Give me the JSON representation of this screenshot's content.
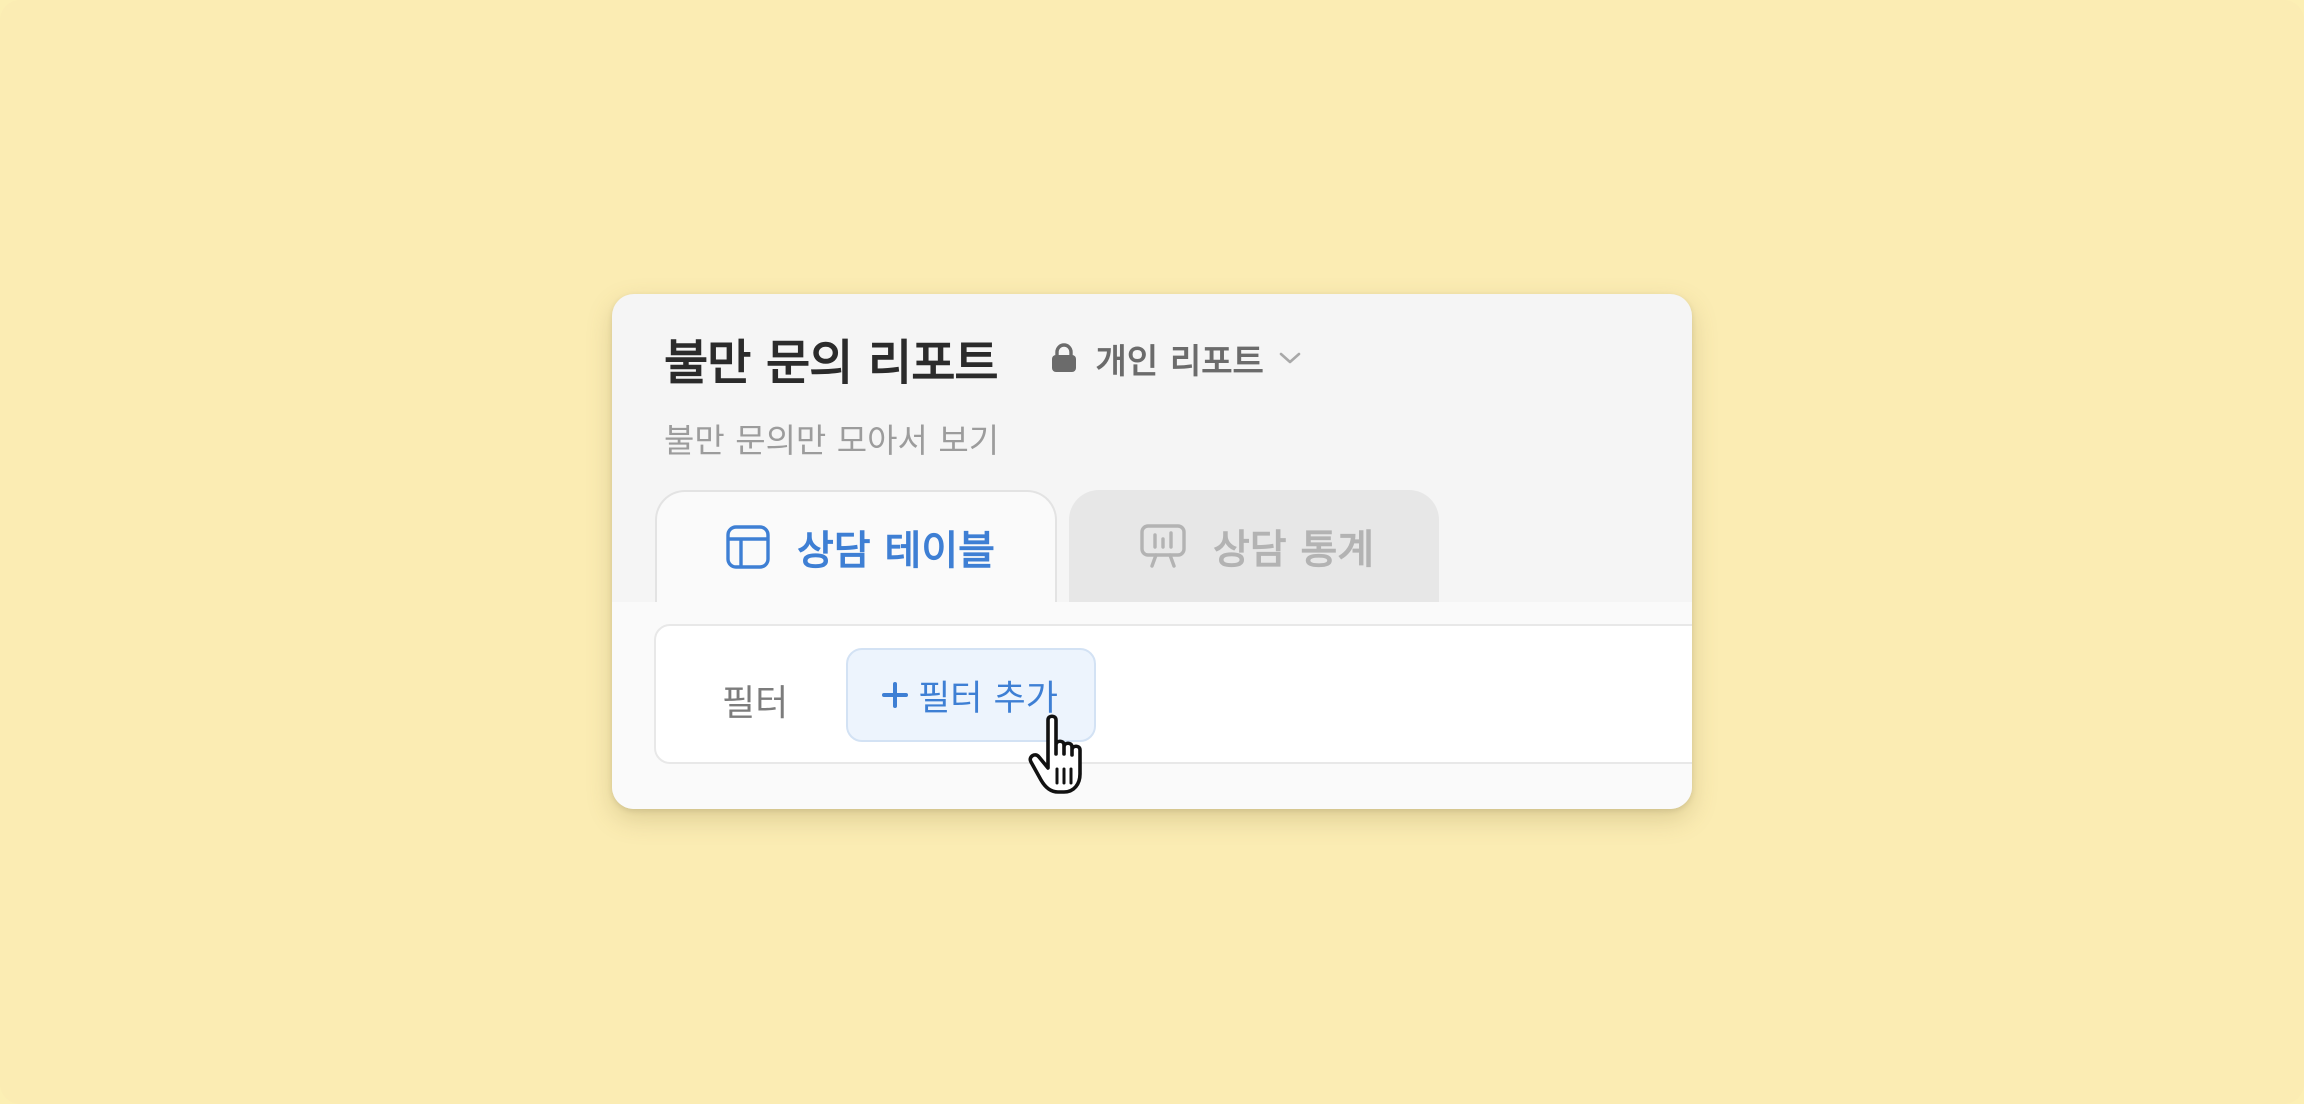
{
  "report": {
    "title": "불만 문의 리포트",
    "subtitle": "불만 문의만 모아서 보기",
    "visibility": {
      "label": "개인 리포트",
      "icon": "lock-icon",
      "dropdown_icon": "chevron-down-icon"
    }
  },
  "tabs": [
    {
      "label": "상담 테이블",
      "icon": "table-icon",
      "active": true
    },
    {
      "label": "상담 통계",
      "icon": "chart-presentation-icon",
      "active": false
    }
  ],
  "filters": {
    "label": "필터",
    "add_button_label": "필터 추가",
    "add_button_icon": "plus-icon"
  },
  "cursor": {
    "icon": "pointer-hand-icon"
  },
  "colors": {
    "page_background": "#fbecb3",
    "card_background": "#f5f5f5",
    "accent": "#3e7fd4",
    "accent_light": "#edf4fd",
    "title_text": "#2b2b2b",
    "muted_text": "#9c9c9c"
  }
}
